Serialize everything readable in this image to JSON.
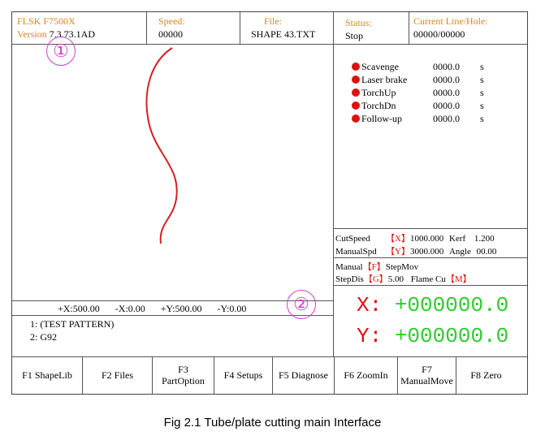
{
  "header": {
    "brand": "FLSK F7500X",
    "version_label": "Version",
    "version_value": "7.3.73.1AD",
    "speed_label": "Speed:",
    "speed_value": "00000",
    "file_label": "File:",
    "file_value": "SHAPE 43.TXT",
    "status_label": "Status:",
    "status_value": "Stop",
    "line_label": "Current Line/Hole:",
    "line_value": "00000/00000"
  },
  "annotations": {
    "one": "①",
    "two": "②"
  },
  "io_status": [
    {
      "name": "Scavenge",
      "value": "0000.0",
      "unit": "s"
    },
    {
      "name": "Laser brake",
      "value": "0000.0",
      "unit": "s"
    },
    {
      "name": "TorchUp",
      "value": "0000.0",
      "unit": "s"
    },
    {
      "name": "TorchDn",
      "value": "0000.0",
      "unit": "s"
    },
    {
      "name": "Follow-up",
      "value": "0000.0",
      "unit": "s"
    }
  ],
  "params": {
    "cutspeed_label": "CutSpeed",
    "cutspeed_key": "【X】",
    "cutspeed_value": "1000.000",
    "kerf_label": "Kerf",
    "kerf_value": "1.200",
    "manualspd_label": "ManualSpd",
    "manualspd_key": "【Y】",
    "manualspd_value": "3000.000",
    "angle_label": "Angle",
    "angle_value": "00.00"
  },
  "mode": {
    "manual_label": "Manual",
    "manual_key": "【F】",
    "manual_value": "StepMov",
    "stepdis_label": "StepDis",
    "stepdis_key": "【G】",
    "stepdis_value": "5.00",
    "flame_label": "Flame Cu",
    "flame_key": "【M】"
  },
  "limits": {
    "xpos": "+X:500.00",
    "xneg": "-X:0.00",
    "ypos": "+Y:500.00",
    "yneg": "-Y:0.00"
  },
  "program": [
    "1: (TEST PATTERN)",
    "2: G92"
  ],
  "coords": {
    "x_label": "X:",
    "x_value": "+000000.0",
    "y_label": "Y:",
    "y_value": "+000000.0"
  },
  "fkeys": [
    {
      "l1": "F1 ShapeLib",
      "l2": ""
    },
    {
      "l1": "F2 Files",
      "l2": ""
    },
    {
      "l1": "F3",
      "l2": "PartOption"
    },
    {
      "l1": "F4 Setups",
      "l2": ""
    },
    {
      "l1": "F5 Diagnose",
      "l2": ""
    },
    {
      "l1": "F6 ZoomIn",
      "l2": ""
    },
    {
      "l1": "F7",
      "l2": "ManualMove"
    },
    {
      "l1": "F8 Zero",
      "l2": ""
    }
  ],
  "caption": "Fig 2.1 Tube/plate cutting main Interface",
  "colors": {
    "header_text": "#d9861f",
    "coord_text": "#2ecc2e",
    "path_stroke": "#d42020",
    "annotation": "#d040d0"
  }
}
